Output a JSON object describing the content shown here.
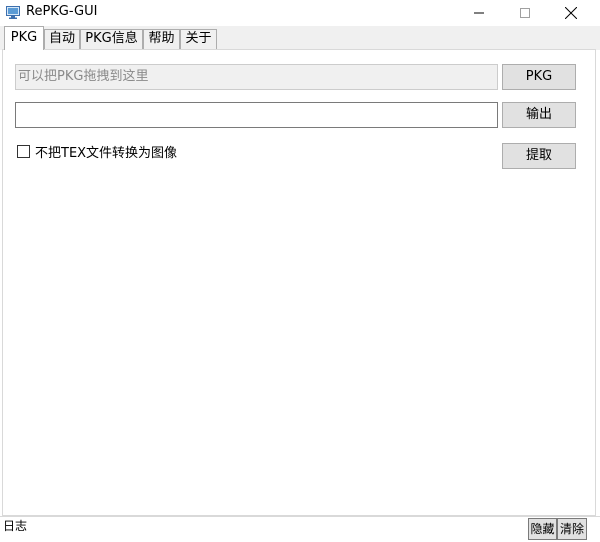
{
  "window": {
    "title": "RePKG-GUI",
    "icon": "app-monitor-icon"
  },
  "tabs": [
    {
      "label": "PKG",
      "active": true
    },
    {
      "label": "自动",
      "active": false
    },
    {
      "label": "PKG信息",
      "active": false
    },
    {
      "label": "帮助",
      "active": false
    },
    {
      "label": "关于",
      "active": false
    }
  ],
  "pkg_tab": {
    "drop_placeholder": "可以把PKG拖拽到这里",
    "output_value": "",
    "pkg_button": "PKG",
    "output_button": "输出",
    "extract_button": "提取",
    "checkbox_label": "不把TEX文件转换为图像",
    "checkbox_checked": false
  },
  "log": {
    "label": "日志",
    "hide_button": "隐藏",
    "clear_button": "清除"
  }
}
